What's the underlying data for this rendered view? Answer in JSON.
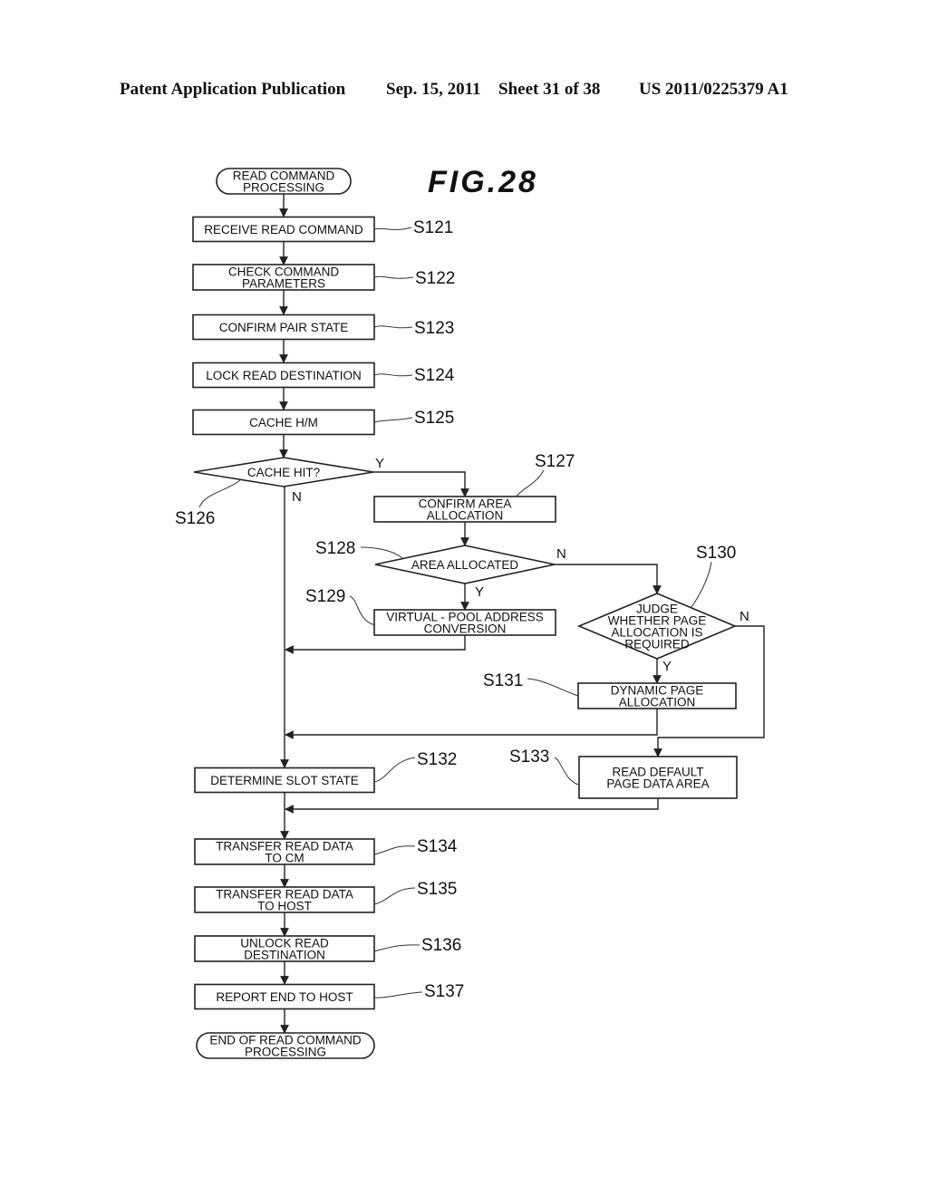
{
  "header": {
    "publication": "Patent Application Publication",
    "date": "Sep. 15, 2011",
    "sheet": "Sheet 31 of 38",
    "number": "US 2011/0225379 A1"
  },
  "figure": {
    "title": "FIG.28",
    "nodes": [
      {
        "id": "start",
        "type": "terminal",
        "lines": [
          "READ COMMAND",
          "PROCESSING"
        ],
        "step": ""
      },
      {
        "id": "s121",
        "type": "process",
        "lines": [
          "RECEIVE READ COMMAND"
        ],
        "step": "S121"
      },
      {
        "id": "s122",
        "type": "process",
        "lines": [
          "CHECK COMMAND",
          "PARAMETERS"
        ],
        "step": "S122"
      },
      {
        "id": "s123",
        "type": "process",
        "lines": [
          "CONFIRM PAIR STATE"
        ],
        "step": "S123"
      },
      {
        "id": "s124",
        "type": "process",
        "lines": [
          "LOCK READ DESTINATION"
        ],
        "step": "S124"
      },
      {
        "id": "s125",
        "type": "process",
        "lines": [
          "CACHE H/M"
        ],
        "step": "S125"
      },
      {
        "id": "s126",
        "type": "decision",
        "lines": [
          "CACHE HIT?"
        ],
        "step": "S126"
      },
      {
        "id": "s127",
        "type": "process",
        "lines": [
          "CONFIRM AREA",
          "ALLOCATION"
        ],
        "step": "S127"
      },
      {
        "id": "s128",
        "type": "decision",
        "lines": [
          "AREA ALLOCATED"
        ],
        "step": "S128"
      },
      {
        "id": "s129",
        "type": "process",
        "lines": [
          "VIRTUAL - POOL ADDRESS",
          "CONVERSION"
        ],
        "step": "S129"
      },
      {
        "id": "s130",
        "type": "decision",
        "lines": [
          "JUDGE",
          "WHETHER PAGE",
          "ALLOCATION IS",
          "REQUIRED"
        ],
        "step": "S130"
      },
      {
        "id": "s131",
        "type": "process",
        "lines": [
          "DYNAMIC PAGE",
          "ALLOCATION"
        ],
        "step": "S131"
      },
      {
        "id": "s132",
        "type": "process",
        "lines": [
          "DETERMINE SLOT STATE"
        ],
        "step": "S132"
      },
      {
        "id": "s133",
        "type": "process",
        "lines": [
          "READ DEFAULT",
          "PAGE DATA AREA"
        ],
        "step": "S133"
      },
      {
        "id": "s134",
        "type": "process",
        "lines": [
          "TRANSFER READ DATA",
          "TO CM"
        ],
        "step": "S134"
      },
      {
        "id": "s135",
        "type": "process",
        "lines": [
          "TRANSFER READ DATA",
          "TO HOST"
        ],
        "step": "S135"
      },
      {
        "id": "s136",
        "type": "process",
        "lines": [
          "UNLOCK READ",
          "DESTINATION"
        ],
        "step": "S136"
      },
      {
        "id": "s137",
        "type": "process",
        "lines": [
          "REPORT END TO HOST"
        ],
        "step": "S137"
      },
      {
        "id": "end",
        "type": "terminal",
        "lines": [
          "END OF READ COMMAND",
          "PROCESSING"
        ],
        "step": ""
      }
    ],
    "edges": [
      {
        "from": "start",
        "to": "s121",
        "label": ""
      },
      {
        "from": "s121",
        "to": "s122",
        "label": ""
      },
      {
        "from": "s122",
        "to": "s123",
        "label": ""
      },
      {
        "from": "s123",
        "to": "s124",
        "label": ""
      },
      {
        "from": "s124",
        "to": "s125",
        "label": ""
      },
      {
        "from": "s125",
        "to": "s126",
        "label": ""
      },
      {
        "from": "s126",
        "to": "s127",
        "label": "Y"
      },
      {
        "from": "s126",
        "to": "s132",
        "label": "N"
      },
      {
        "from": "s127",
        "to": "s128",
        "label": ""
      },
      {
        "from": "s128",
        "to": "s129",
        "label": "Y"
      },
      {
        "from": "s128",
        "to": "s130",
        "label": "N"
      },
      {
        "from": "s129",
        "to": "s132",
        "label": ""
      },
      {
        "from": "s130",
        "to": "s131",
        "label": "Y"
      },
      {
        "from": "s130",
        "to": "s133",
        "label": "N"
      },
      {
        "from": "s131",
        "to": "s132",
        "label": ""
      },
      {
        "from": "s132",
        "to": "s134",
        "label": ""
      },
      {
        "from": "s133",
        "to": "s134",
        "label": ""
      },
      {
        "from": "s134",
        "to": "s135",
        "label": ""
      },
      {
        "from": "s135",
        "to": "s136",
        "label": ""
      },
      {
        "from": "s136",
        "to": "s137",
        "label": ""
      },
      {
        "from": "s137",
        "to": "end",
        "label": ""
      }
    ]
  }
}
